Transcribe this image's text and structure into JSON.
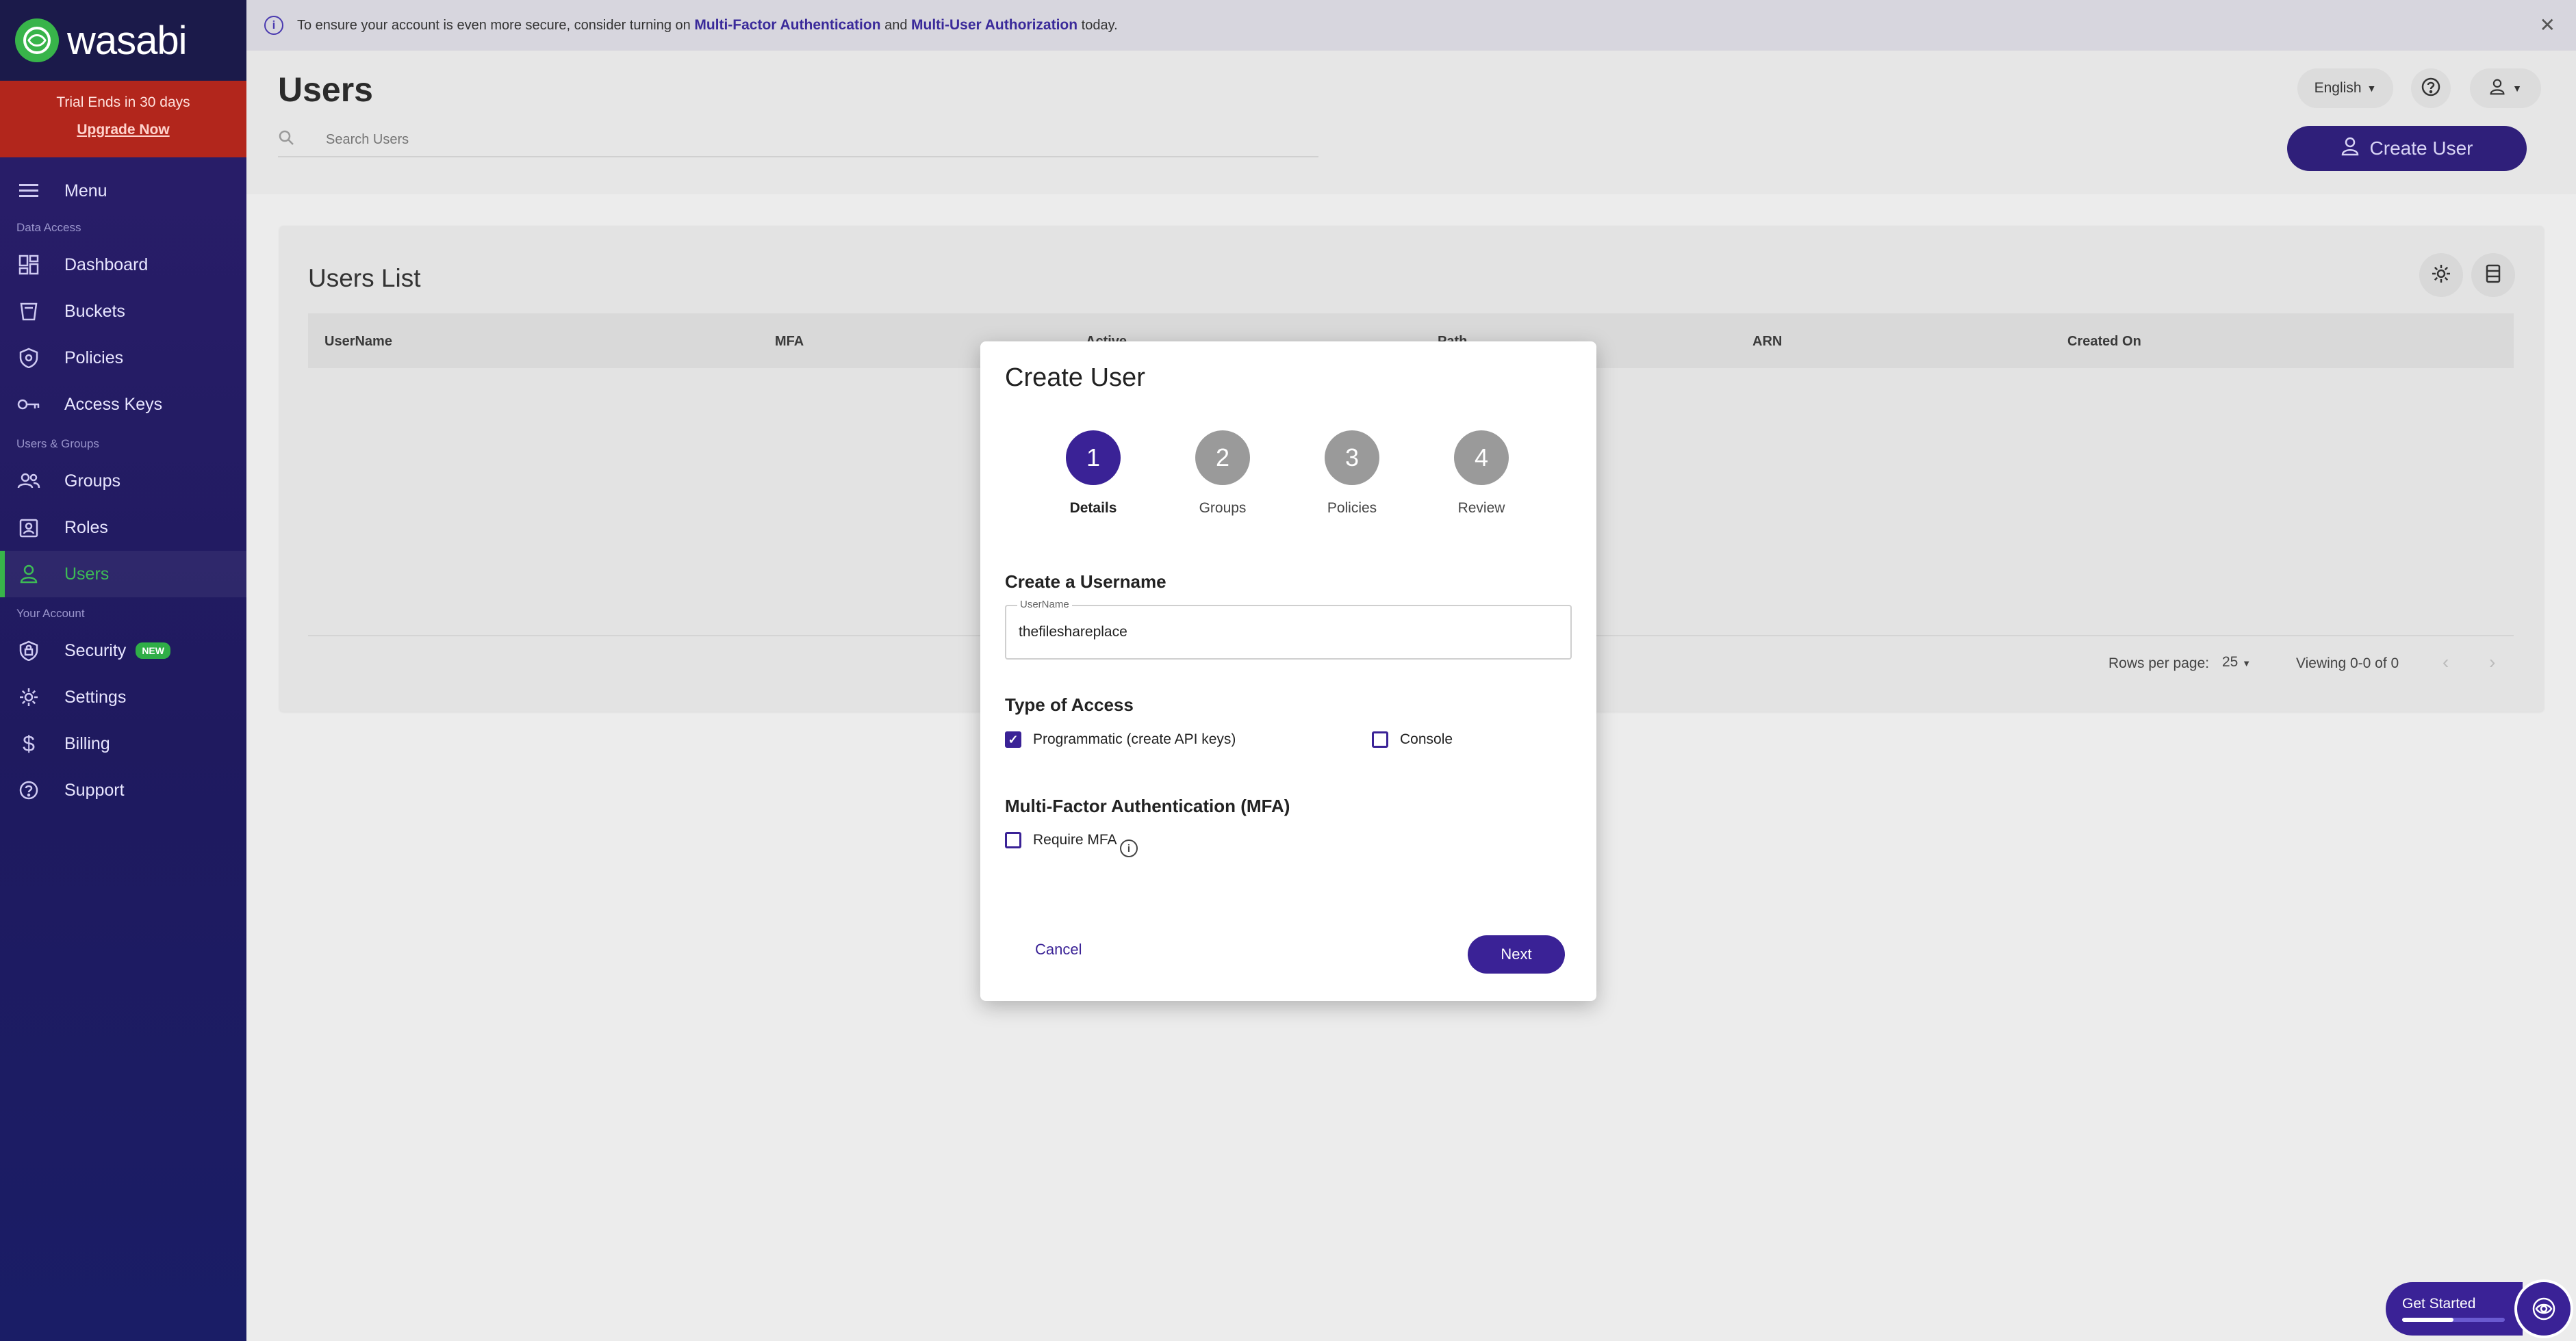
{
  "sidebar": {
    "logo_text": "wasabi",
    "trial_text": "Trial Ends in 30 days",
    "upgrade_label": "Upgrade Now",
    "menu_label": "Menu",
    "sections": {
      "data_access": "Data Access",
      "users_groups": "Users & Groups",
      "your_account": "Your Account"
    },
    "items": {
      "dashboard": "Dashboard",
      "buckets": "Buckets",
      "policies": "Policies",
      "access_keys": "Access Keys",
      "groups": "Groups",
      "roles": "Roles",
      "users": "Users",
      "security": "Security",
      "security_badge": "NEW",
      "settings": "Settings",
      "billing": "Billing",
      "support": "Support"
    },
    "active_item": "users",
    "accent_color": "#38b44a"
  },
  "banner": {
    "text_before": "To ensure your account is even more secure, consider turning on",
    "link1": "Multi-Factor Authentication",
    "text_middle": "and",
    "link2": "Multi-User Authorization",
    "text_after": "today."
  },
  "header": {
    "title": "Users",
    "search_placeholder": "Search Users",
    "language": "English",
    "create_user_label": "Create User"
  },
  "users_list": {
    "title": "Users List",
    "columns": [
      "UserName",
      "MFA",
      "Active",
      "Path",
      "ARN",
      "Created On"
    ],
    "rows": [],
    "rows_per_page_label": "Rows per page:",
    "rows_per_page_value": "25",
    "viewing_text": "Viewing 0-0 of 0"
  },
  "modal": {
    "title": "Create User",
    "steps": [
      {
        "number": "1",
        "label": "Details"
      },
      {
        "number": "2",
        "label": "Groups"
      },
      {
        "number": "3",
        "label": "Policies"
      },
      {
        "number": "4",
        "label": "Review"
      }
    ],
    "active_step": 1,
    "username_heading": "Create a Username",
    "username_field_label": "UserName",
    "username_value": "thefileshareplace",
    "access_heading": "Type of Access",
    "programmatic_label": "Programmatic (create API keys)",
    "programmatic_checked": true,
    "console_label": "Console",
    "console_checked": false,
    "mfa_heading": "Multi-Factor Authentication (MFA)",
    "require_mfa_label": "Require MFA",
    "require_mfa_checked": false,
    "cancel_label": "Cancel",
    "next_label": "Next",
    "primary_color": "#3a2296"
  },
  "get_started": {
    "label": "Get Started",
    "progress_fraction": 0.5
  }
}
